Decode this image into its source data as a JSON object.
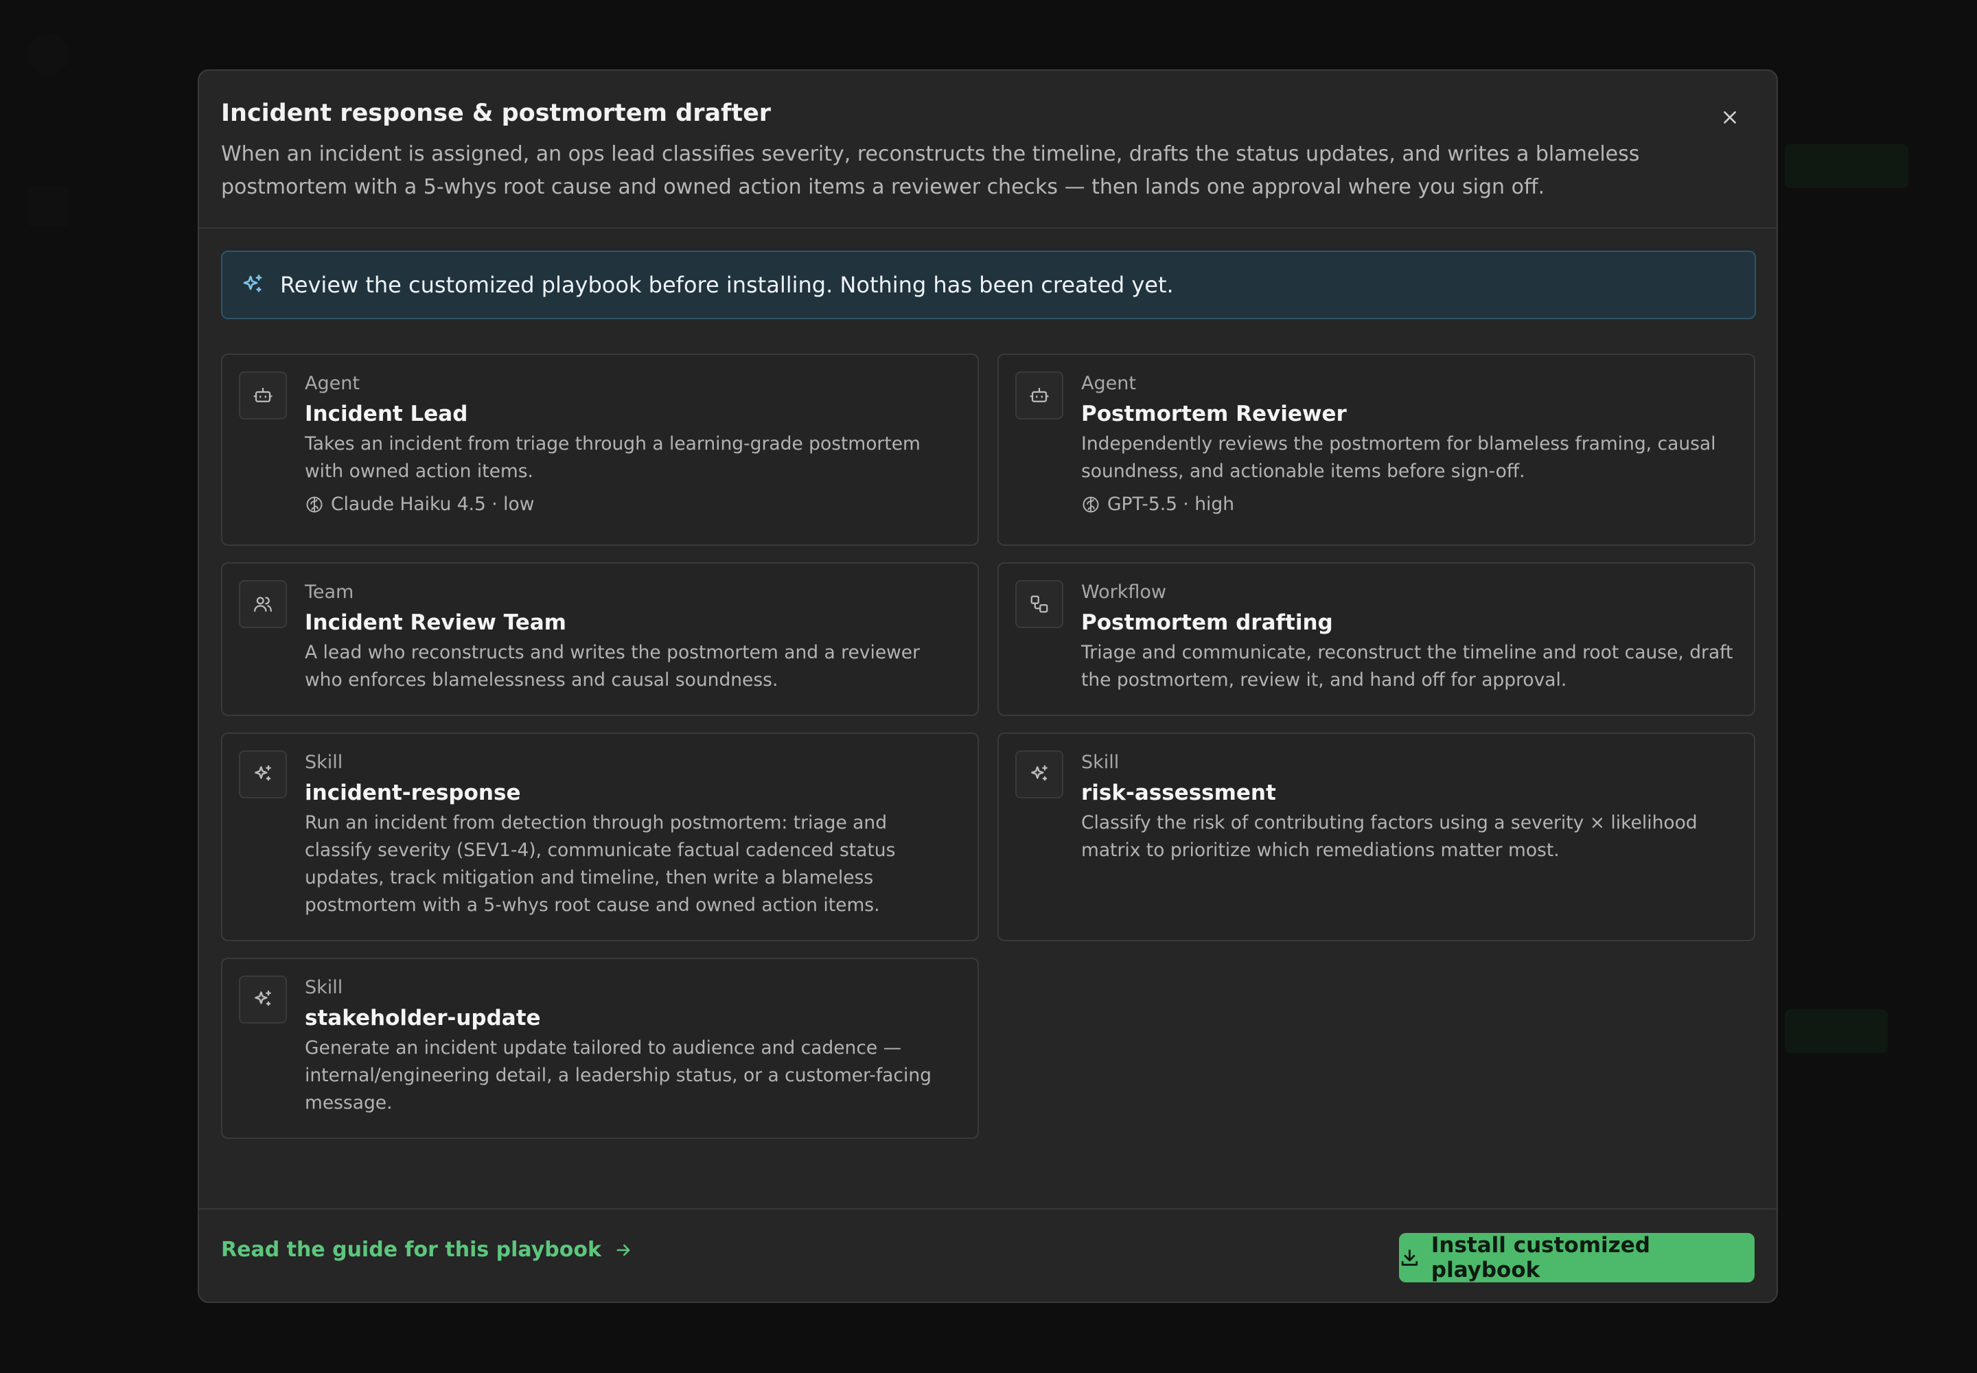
{
  "modal": {
    "title": "Incident response & postmortem drafter",
    "description": "When an incident is assigned, an ops lead classifies severity, reconstructs the timeline, drafts the status updates, and writes a blameless postmortem with a 5-whys root cause and owned action items a reviewer checks — then lands one approval where you sign off.",
    "close_icon": "close-icon"
  },
  "notice": {
    "icon": "sparkles-icon",
    "text": "Review the customized playbook before installing. Nothing has been created yet."
  },
  "cards": [
    {
      "kind": "Agent",
      "name": "Incident Lead",
      "icon": "robot-icon",
      "description": "Takes an incident from triage through a learning-grade postmortem with owned action items.",
      "model": "Claude Haiku 4.5 · low"
    },
    {
      "kind": "Agent",
      "name": "Postmortem Reviewer",
      "icon": "robot-icon",
      "description": "Independently reviews the postmortem for blameless framing, causal soundness, and actionable items before sign-off.",
      "model": "GPT-5.5 · high"
    },
    {
      "kind": "Team",
      "name": "Incident Review Team",
      "icon": "users-icon",
      "description": "A lead who reconstructs and writes the postmortem and a reviewer who enforces blamelessness and causal soundness."
    },
    {
      "kind": "Workflow",
      "name": "Postmortem drafting",
      "icon": "workflow-icon",
      "description": "Triage and communicate, reconstruct the timeline and root cause, draft the postmortem, review it, and hand off for approval."
    },
    {
      "kind": "Skill",
      "name": "incident-response",
      "icon": "sparkles-icon",
      "description": "Run an incident from detection through postmortem: triage and classify severity (SEV1-4), communicate factual cadenced status updates, track mitigation and timeline, then write a blameless postmortem with a 5-whys root cause and owned action items."
    },
    {
      "kind": "Skill",
      "name": "risk-assessment",
      "icon": "sparkles-icon",
      "description": "Classify the risk of contributing factors using a severity × likelihood matrix to prioritize which remediations matter most."
    },
    {
      "kind": "Skill",
      "name": "stakeholder-update",
      "icon": "sparkles-icon",
      "description": "Generate an incident update tailored to audience and cadence — internal/engineering detail, a leadership status, or a customer-facing message."
    }
  ],
  "guide_link": "Read the guide for this playbook",
  "install_button": "Install customized playbook",
  "colors": {
    "accent": "#4cba6a",
    "notice_bg": "#21333d",
    "modal_bg": "#262626"
  }
}
